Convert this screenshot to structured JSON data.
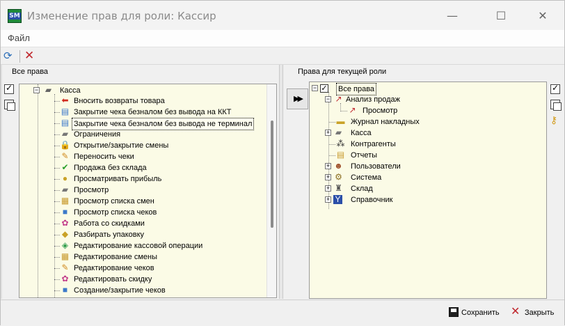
{
  "window": {
    "title": "Изменение прав для роли: Кассир",
    "app_icon_text": "SM"
  },
  "menu": {
    "file_label": "Файл"
  },
  "left_panel": {
    "header": "Все права",
    "root": {
      "label": "Касса"
    },
    "items": [
      {
        "label": "Вносить возвраты товара",
        "icon": "return-arrow-icon"
      },
      {
        "label": "Закрытие чека безналом без вывода на ККТ",
        "icon": "receipt-card-icon"
      },
      {
        "label": "Закрытие чека безналом без вывода не терминал",
        "icon": "receipt-card-icon",
        "selected": true
      },
      {
        "label": "Ограничения",
        "icon": "cash-register-icon"
      },
      {
        "label": "Открытие/закрытие смены",
        "icon": "lock-icon"
      },
      {
        "label": "Переносить чеки",
        "icon": "pencil-icon"
      },
      {
        "label": "Продажа без склада",
        "icon": "check-mark-icon"
      },
      {
        "label": "Просматривать прибыль",
        "icon": "coins-icon"
      },
      {
        "label": "Просмотр",
        "icon": "cash-register-icon"
      },
      {
        "label": "Просмотр списка смен",
        "icon": "shift-list-icon"
      },
      {
        "label": "Просмотр списка чеков",
        "icon": "receipt-list-icon"
      },
      {
        "label": "Работа со скидками",
        "icon": "gift-icon"
      },
      {
        "label": "Разбирать упаковку",
        "icon": "box-icon"
      },
      {
        "label": "Редактирование кассовой операции",
        "icon": "money-edit-icon"
      },
      {
        "label": "Редактирование смены",
        "icon": "shift-edit-icon"
      },
      {
        "label": "Редактирование чеков",
        "icon": "receipt-edit-icon"
      },
      {
        "label": "Редактировать скидку",
        "icon": "gift-icon"
      },
      {
        "label": "Создание/закрытие чеков",
        "icon": "receipt-list-icon"
      }
    ]
  },
  "right_panel": {
    "header": "Права для текущей роли",
    "root": {
      "label": "Все права"
    },
    "items": [
      {
        "label": "Анализ продаж",
        "icon": "chart-icon",
        "expander": "⊟",
        "level": 1
      },
      {
        "label": "Просмотр",
        "icon": "chart-icon",
        "expander": "",
        "level": 2
      },
      {
        "label": "Журнал накладных",
        "icon": "invoice-icon",
        "expander": "",
        "level": 1
      },
      {
        "label": "Касса",
        "icon": "cash-register-icon",
        "expander": "⊞",
        "level": 1
      },
      {
        "label": "Контрагенты",
        "icon": "contractors-icon",
        "expander": "",
        "level": 1
      },
      {
        "label": "Отчеты",
        "icon": "report-icon",
        "expander": "",
        "level": 1
      },
      {
        "label": "Пользователи",
        "icon": "users-icon",
        "expander": "⊞",
        "level": 1
      },
      {
        "label": "Система",
        "icon": "gears-icon",
        "expander": "⊞",
        "level": 1
      },
      {
        "label": "Склад",
        "icon": "warehouse-icon",
        "expander": "⊞",
        "level": 1
      },
      {
        "label": "Справочник",
        "icon": "directory-icon",
        "expander": "⊞",
        "level": 1
      }
    ]
  },
  "buttons": {
    "save_label": "Сохранить",
    "close_label": "Закрыть",
    "transfer_label": "▶▶"
  }
}
